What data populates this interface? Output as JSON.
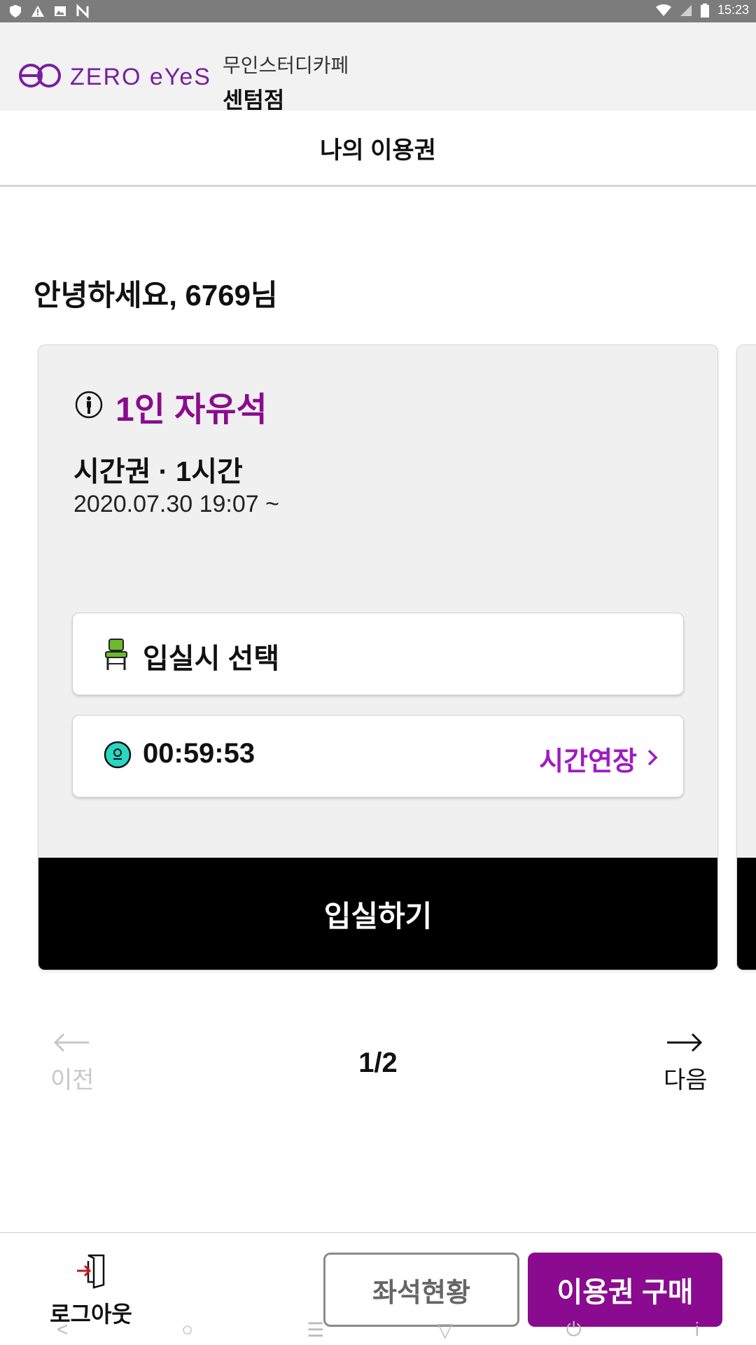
{
  "status_bar": {
    "time": "15:23"
  },
  "header": {
    "logo_text": "ZERO eYeS",
    "store_type": "무인스터디카페",
    "store_name": "센텀점"
  },
  "page_title": "나의 이용권",
  "greeting": "안녕하세요, 6769님",
  "ticket": {
    "seat_type": "1인 자유석",
    "plan": "시간권 · 1시간",
    "start_date": "2020.07.30 19:07 ~",
    "seat_select_label": "입실시 선택",
    "timer": "00:59:53",
    "extend_label": "시간연장",
    "enter_label": "입실하기"
  },
  "pager": {
    "prev_label": "이전",
    "next_label": "다음",
    "count": "1/2"
  },
  "bottom_bar": {
    "logout_label": "로그아웃",
    "seat_status_label": "좌석현황",
    "buy_label": "이용권 구매"
  },
  "colors": {
    "brand_purple": "#8a0b8f",
    "accent_violet": "#a01ac3",
    "timer_icon": "#2ad7c2",
    "chair_icon": "#6dbb2c"
  }
}
